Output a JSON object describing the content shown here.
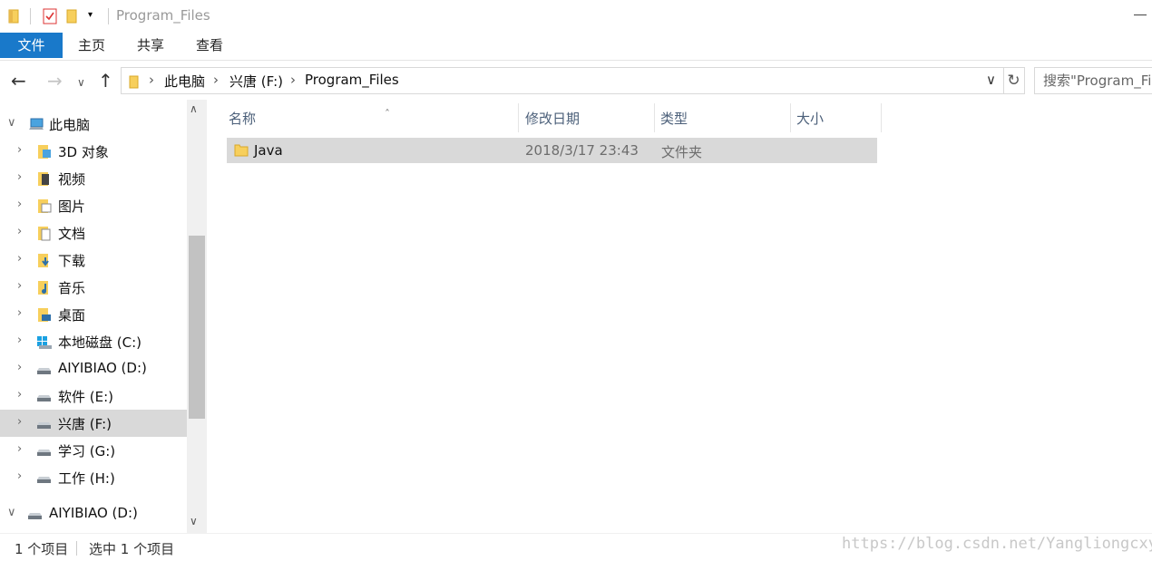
{
  "window": {
    "title": "Program_Files"
  },
  "ribbon": {
    "tabs": [
      "文件",
      "主页",
      "共享",
      "查看"
    ]
  },
  "address": {
    "crumbs": [
      "此电脑",
      "兴唐 (F:)",
      "Program_Files"
    ]
  },
  "search": {
    "placeholder": "搜索\"Program_Fi"
  },
  "nav_tree": {
    "items": [
      {
        "label": "此电脑",
        "icon": "computer-icon",
        "expanded": true
      },
      {
        "label": "3D 对象",
        "icon": "3d-objects-icon"
      },
      {
        "label": "视频",
        "icon": "videos-icon"
      },
      {
        "label": "图片",
        "icon": "pictures-icon"
      },
      {
        "label": "文档",
        "icon": "documents-icon"
      },
      {
        "label": "下载",
        "icon": "downloads-icon"
      },
      {
        "label": "音乐",
        "icon": "music-icon"
      },
      {
        "label": "桌面",
        "icon": "desktop-icon"
      },
      {
        "label": "本地磁盘 (C:)",
        "icon": "windows-drive-icon"
      },
      {
        "label": "AIYIBIAO (D:)",
        "icon": "drive-icon"
      },
      {
        "label": "软件 (E:)",
        "icon": "drive-icon"
      },
      {
        "label": "兴唐 (F:)",
        "icon": "drive-icon",
        "selected": true
      },
      {
        "label": "学习 (G:)",
        "icon": "drive-icon"
      },
      {
        "label": "工作 (H:)",
        "icon": "drive-icon"
      },
      {
        "label": "AIYIBIAO (D:)",
        "icon": "drive-icon",
        "expanded": true
      }
    ]
  },
  "columns": [
    "名称",
    "修改日期",
    "类型",
    "大小"
  ],
  "files": [
    {
      "name": "Java",
      "modified": "2018/3/17 23:43",
      "type": "文件夹",
      "size": ""
    }
  ],
  "status": {
    "count": "1 个项目",
    "selected": "选中 1 个项目"
  },
  "watermark": "https://blog.csdn.net/Yangliongcxy",
  "colors": {
    "accent": "#1979ca",
    "selection": "#d9d9d9",
    "header_text": "#4c607a",
    "folder": "#f7cf5c"
  }
}
